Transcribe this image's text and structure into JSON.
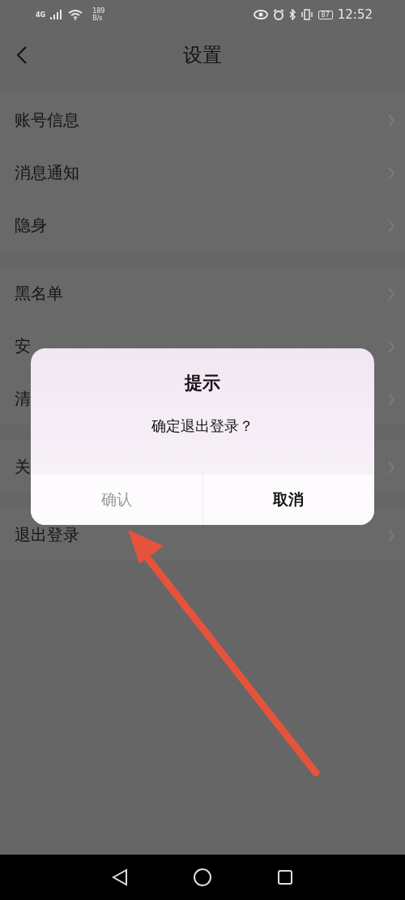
{
  "status_bar": {
    "network": "4G",
    "speed": "189",
    "speed_unit": "B/s",
    "battery": "87",
    "time": "12:52"
  },
  "header": {
    "title": "设置"
  },
  "groups": [
    {
      "items": [
        {
          "label": "账号信息"
        },
        {
          "label": "消息通知"
        },
        {
          "label": "隐身"
        }
      ]
    },
    {
      "items": [
        {
          "label": "黑名单"
        },
        {
          "label": "安"
        },
        {
          "label": "清"
        }
      ]
    },
    {
      "items": [
        {
          "label": "关"
        }
      ]
    },
    {
      "items": [
        {
          "label": "退出登录"
        }
      ]
    }
  ],
  "dialog": {
    "title": "提示",
    "message": "确定退出登录？",
    "buttons": [
      {
        "label": "确认",
        "disabled": true
      },
      {
        "label": "取消",
        "disabled": false
      }
    ]
  }
}
